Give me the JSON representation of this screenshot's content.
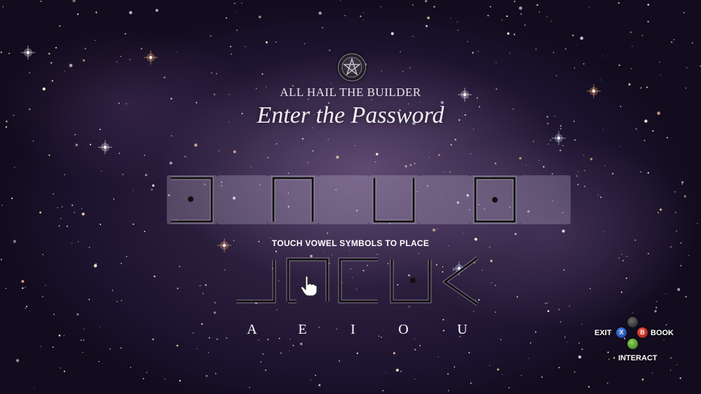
{
  "header": {
    "emblem_icon": "pentagram-emblem-icon",
    "subtitle": "ALL HAIL THE BUILDER",
    "title": "Enter the Password"
  },
  "password_slots": [
    {
      "glyph": "bracket-right-dot",
      "filled": true
    },
    {
      "glyph": "empty",
      "filled": false
    },
    {
      "glyph": "arch-down",
      "filled": true
    },
    {
      "glyph": "empty",
      "filled": false
    },
    {
      "glyph": "cup-up",
      "filled": true
    },
    {
      "glyph": "empty",
      "filled": false
    },
    {
      "glyph": "box-dot",
      "filled": true
    },
    {
      "glyph": "empty",
      "filled": false
    }
  ],
  "hint_text": "TOUCH VOWEL SYMBOLS TO PLACE",
  "vowel_symbols": [
    {
      "vowel": "A",
      "glyph": "hook-left"
    },
    {
      "vowel": "E",
      "glyph": "arch-bar"
    },
    {
      "vowel": "I",
      "glyph": "corner-bracket"
    },
    {
      "vowel": "O",
      "glyph": "open-box-dot"
    },
    {
      "vowel": "U",
      "glyph": "chevron-left"
    }
  ],
  "vowel_labels": [
    "A",
    "E",
    "I",
    "O",
    "U"
  ],
  "controls": {
    "exit_label": "EXIT",
    "book_label": "BOOK",
    "interact_label": "INTERACT",
    "buttons": {
      "x": "X",
      "b": "B",
      "y": "",
      "a": ""
    }
  },
  "colors": {
    "glyph_stroke": "#111111",
    "glyph_glow": "#dcd3e6",
    "slot_fill": "rgba(200,190,215,0.28)"
  }
}
